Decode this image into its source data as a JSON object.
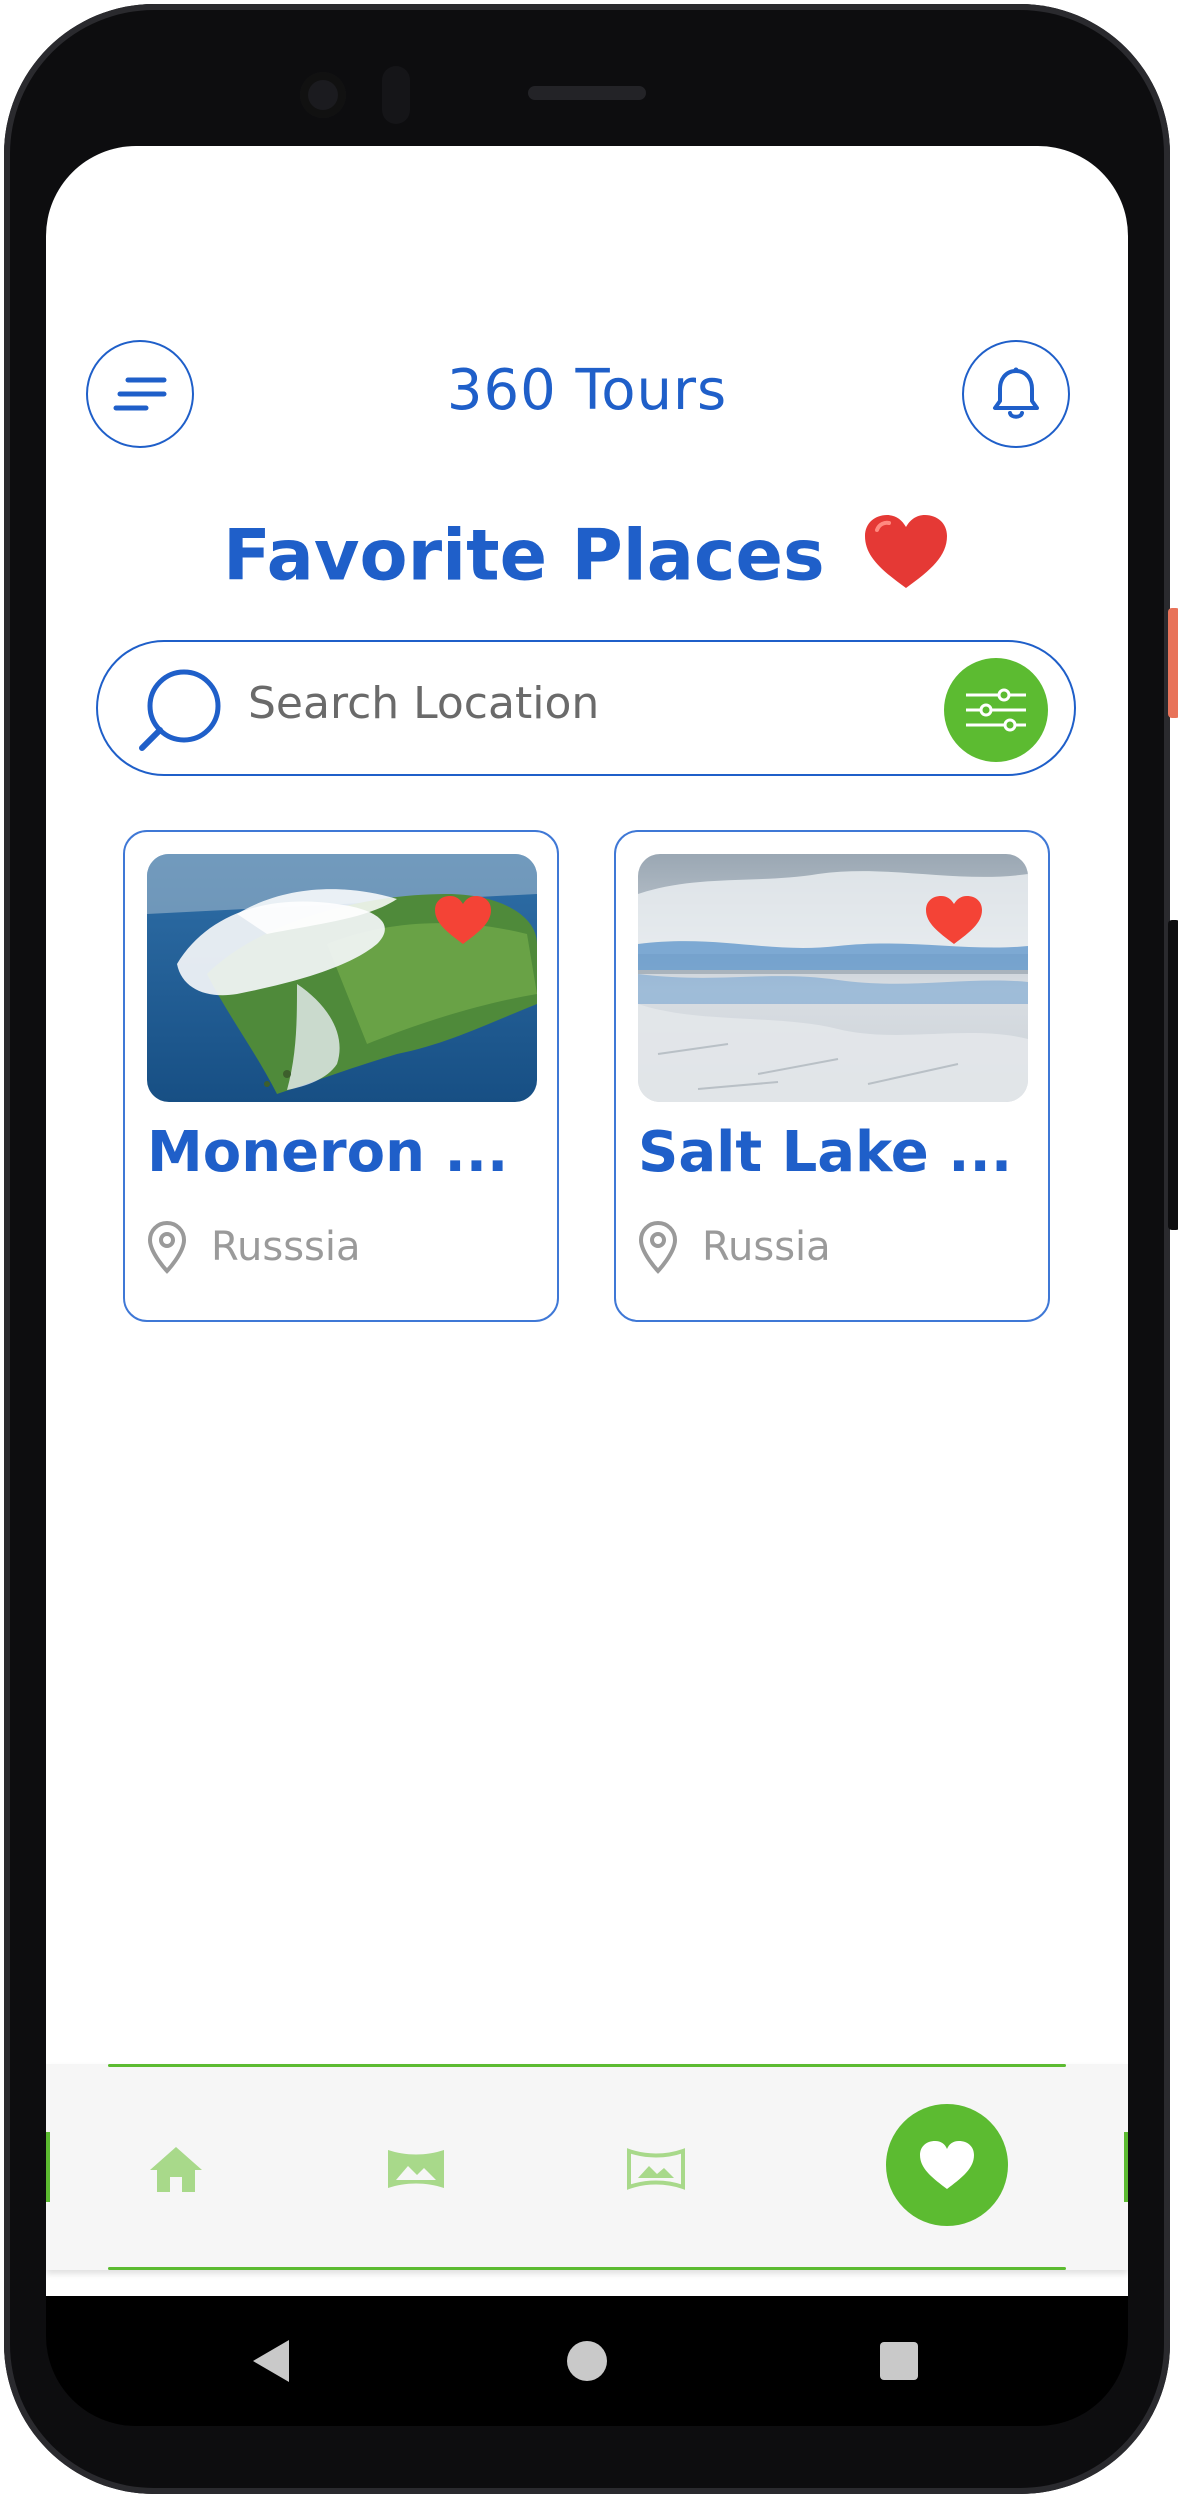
{
  "header": {
    "app_title": "360 Tours",
    "menu_icon": "menu-lines-icon",
    "notification_icon": "bell-icon"
  },
  "page": {
    "title": "Favorite Places",
    "title_emoji": "❤️"
  },
  "search": {
    "placeholder": "Search Location",
    "value": "",
    "filter_icon": "sliders-icon"
  },
  "places": [
    {
      "name": "Moneron ...",
      "location": "Russsia",
      "favorite": true
    },
    {
      "name": "Salt Lake ...",
      "location": "Russia",
      "favorite": true
    }
  ],
  "bottom_nav": {
    "items": [
      {
        "icon": "home-icon",
        "active": false
      },
      {
        "icon": "panorama-icon",
        "active": false
      },
      {
        "icon": "panorama-outline-icon",
        "active": false
      },
      {
        "icon": "heart-icon",
        "active": true
      }
    ]
  },
  "colors": {
    "primary": "#1f5fc9",
    "accent": "#5cbb31",
    "heart": "#f44336",
    "muted_text": "#9a9a9a"
  }
}
